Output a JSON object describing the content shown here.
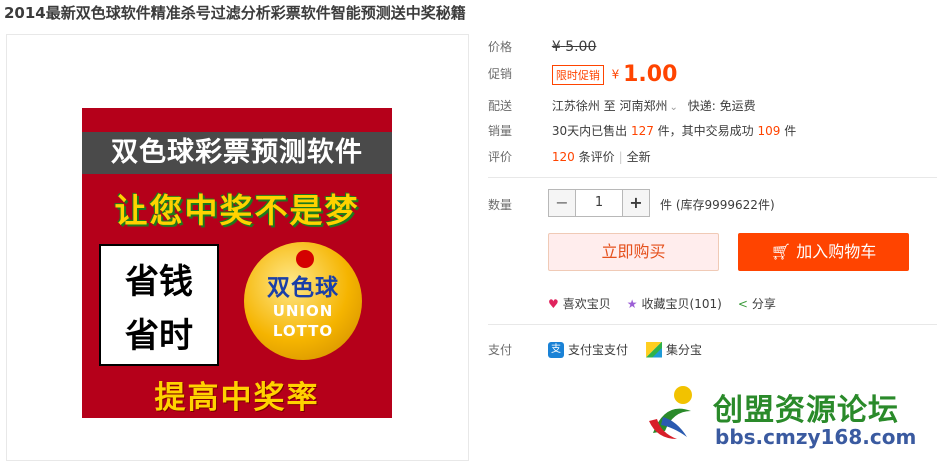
{
  "title": "2014最新双色球软件精准杀号过滤分析彩票软件智能预测送中奖秘籍",
  "promo_image": {
    "line1": "双色球彩票预测软件",
    "line2": "让您中奖不是梦",
    "box_line1": "省钱",
    "box_line2": "省时",
    "logo_cn": "双色球",
    "logo_en1": "UNION",
    "logo_en2": "LOTTO",
    "line3": "提高中奖率"
  },
  "price": {
    "label": "价格",
    "currency": "¥",
    "original": "5.00"
  },
  "promotion": {
    "label": "促销",
    "tag": "限时促销",
    "currency": "¥",
    "value": "1.00"
  },
  "delivery": {
    "label": "配送",
    "from": "江苏徐州",
    "to_word": "至",
    "to": "河南郑州",
    "express": "快递: 免运费"
  },
  "sales": {
    "label": "销量",
    "prefix": "30天内已售出",
    "sold": "127",
    "mid": "件，其中交易成功",
    "success": "109",
    "suffix": "件"
  },
  "reviews": {
    "label": "评价",
    "count": "120",
    "unit": "条评价",
    "extra": "全新"
  },
  "quantity": {
    "label": "数量",
    "value": "1",
    "stock": "件 (库存9999622件)"
  },
  "buttons": {
    "buy_now": "立即购买",
    "add_cart": "加入购物车"
  },
  "actions": {
    "like": "喜欢宝贝",
    "favorite": "收藏宝贝(101)",
    "share": "分享"
  },
  "payment": {
    "label": "支付",
    "alipay": "支付宝支付",
    "jfb": "集分宝"
  },
  "watermark": {
    "name": "创盟资源论坛",
    "url": "bbs.cmzy168.com"
  },
  "colors": {
    "accent": "#ff4400",
    "promo_bg": "#b5001a"
  }
}
